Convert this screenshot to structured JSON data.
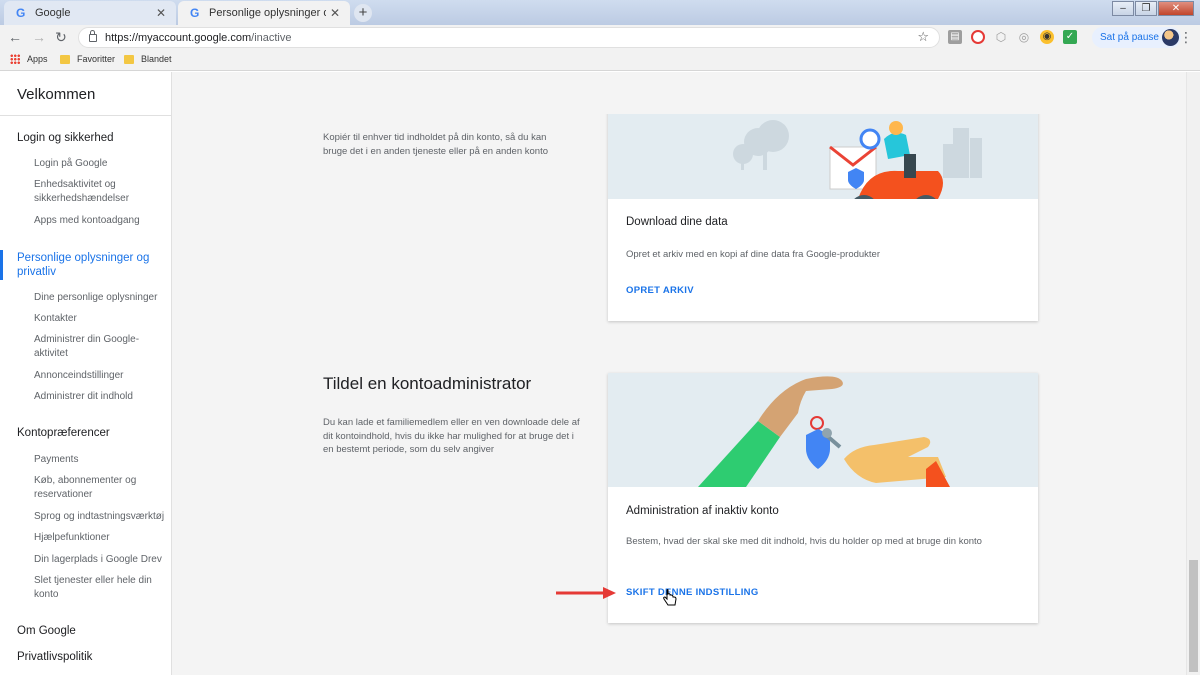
{
  "browser": {
    "tabs": [
      {
        "title": "Google",
        "active": false
      },
      {
        "title": "Personlige oplysninger og privatliv",
        "active": true
      }
    ],
    "url_host": "https://myaccount.google.com",
    "url_path": "/inactive",
    "profile_status": "Sat på pause",
    "bookmarks": [
      "Apps",
      "Favoritter",
      "Blandet"
    ]
  },
  "sidebar": {
    "welcome": "Velkommen",
    "sections": [
      {
        "label": "Login og sikkerhed",
        "items": [
          "Login på Google",
          "Enhedsaktivitet og sikkerhedshændelser",
          "Apps med kontoadgang"
        ]
      },
      {
        "label": "Personlige oplysninger og privatliv",
        "active": true,
        "items": [
          "Dine personlige oplysninger",
          "Kontakter",
          "Administrer din Google-aktivitet",
          "Annonceindstillinger",
          "Administrer dit indhold"
        ]
      },
      {
        "label": "Kontopræferencer",
        "items": [
          "Payments",
          "Køb, abonnementer og reservationer",
          "Sprog og indtastningsværktøj",
          "Hjælpefunktioner",
          "Din lagerplads i Google Drev",
          "Slet tjenester eller hele din konto"
        ]
      },
      {
        "label": "Om Google",
        "items": []
      },
      {
        "label": "Privatlivspolitik",
        "items": []
      }
    ]
  },
  "header": {
    "title": "Personlige oplysninger og privatliv"
  },
  "main": {
    "copy_section": {
      "description": "Kopiér til enhver tid indholdet på din konto, så du kan bruge det i en anden tjeneste eller på en anden konto",
      "card": {
        "title": "Download dine data",
        "text": "Opret et arkiv med en kopi af dine data fra Google-produkter",
        "action": "OPRET ARKIV"
      }
    },
    "admin_section": {
      "title": "Tildel en kontoadministrator",
      "description": "Du kan lade et familiemedlem eller en ven downloade dele af dit kontoindhold, hvis du ikke har mulighed for at bruge det i en bestemt periode, som du selv angiver",
      "card": {
        "title": "Administration af inaktiv konto",
        "text": "Bestem, hvad der skal ske med dit indhold, hvis du holder op med at bruge din konto",
        "action": "SKIFT DENNE INDSTILLING"
      }
    }
  },
  "colors": {
    "accent": "#1a73e8",
    "header": "#4285f4",
    "annotation_arrow": "#e53935"
  }
}
